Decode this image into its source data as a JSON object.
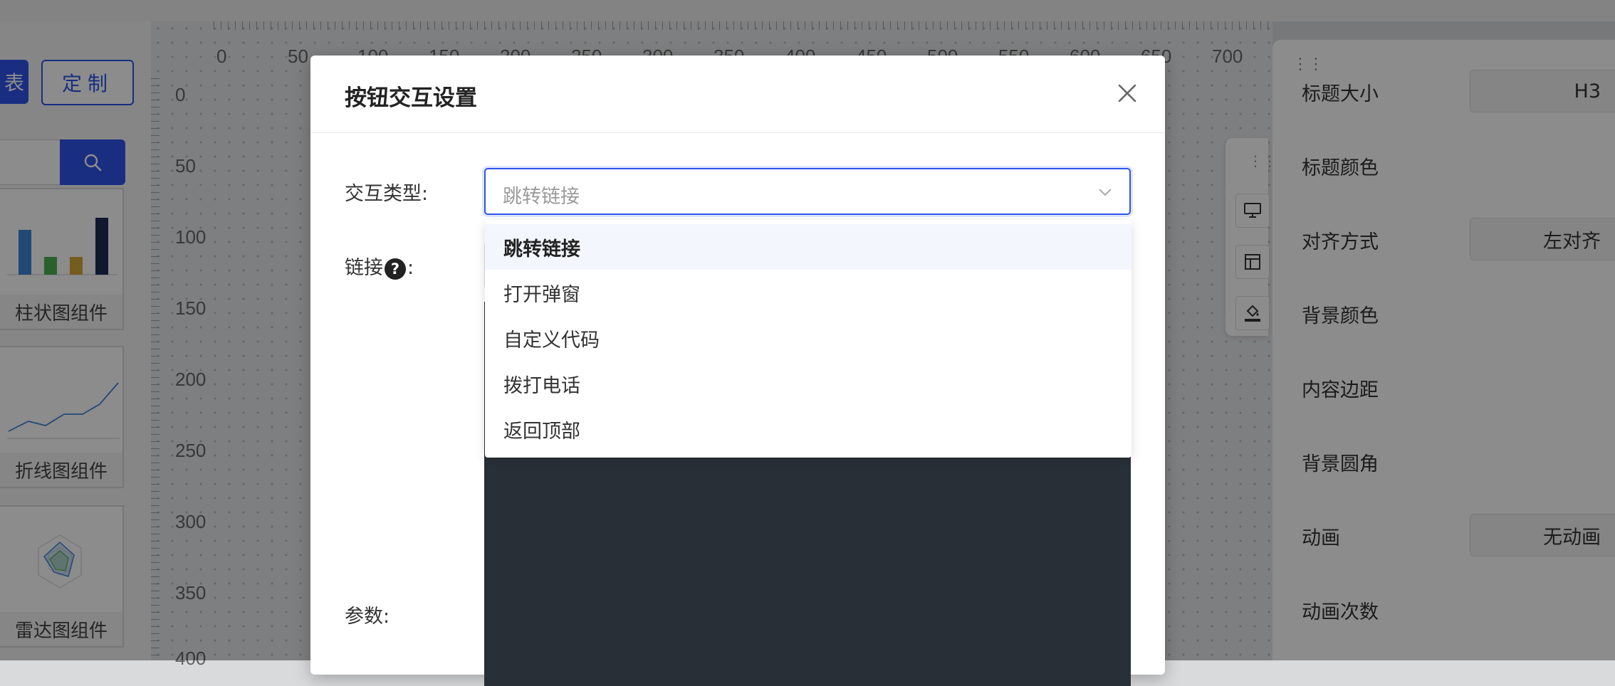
{
  "canvas": {
    "ruler_top": [
      "0",
      "50",
      "100",
      "150",
      "200",
      "250",
      "300",
      "350",
      "400",
      "450",
      "500",
      "550",
      "600",
      "650",
      "700"
    ],
    "ruler_left": [
      "0",
      "50",
      "100",
      "150",
      "200",
      "250",
      "300",
      "350",
      "400"
    ]
  },
  "left_panel": {
    "primary_button_label": "表",
    "custom_button_label": "定制",
    "components": [
      {
        "label": "柱状图组件",
        "thumb": "bar-chart-thumbnail"
      },
      {
        "label": "折线图组件",
        "thumb": "line-chart-thumbnail"
      },
      {
        "label": "雷达图组件",
        "thumb": "radar-chart-thumbnail"
      }
    ]
  },
  "right_panel": {
    "rows": [
      {
        "label": "标题大小",
        "value": "H3"
      },
      {
        "label": "标题颜色",
        "value": ""
      },
      {
        "label": "对齐方式",
        "value": "左对齐"
      },
      {
        "label": "背景颜色",
        "value": ""
      },
      {
        "label": "内容边距",
        "value": ""
      },
      {
        "label": "背景圆角",
        "value": ""
      },
      {
        "label": "动画",
        "value": "无动画"
      },
      {
        "label": "动画次数",
        "value": ""
      }
    ]
  },
  "modal": {
    "title": "按钮交互设置",
    "interaction_type_label": "交互类型:",
    "interaction_type_value": "跳转链接",
    "link_label": "链接",
    "link_suffix": ":",
    "help_glyph": "?",
    "params_label": "参数:",
    "dropdown_options": [
      "跳转链接",
      "打开弹窗",
      "自定义代码",
      "拨打电话",
      "返回顶部"
    ],
    "selected_option": "跳转链接"
  },
  "colors": {
    "primary": "#2f54eb",
    "editor_bg": "#282f36",
    "overlay": "rgba(0,0,0,0.45)"
  }
}
